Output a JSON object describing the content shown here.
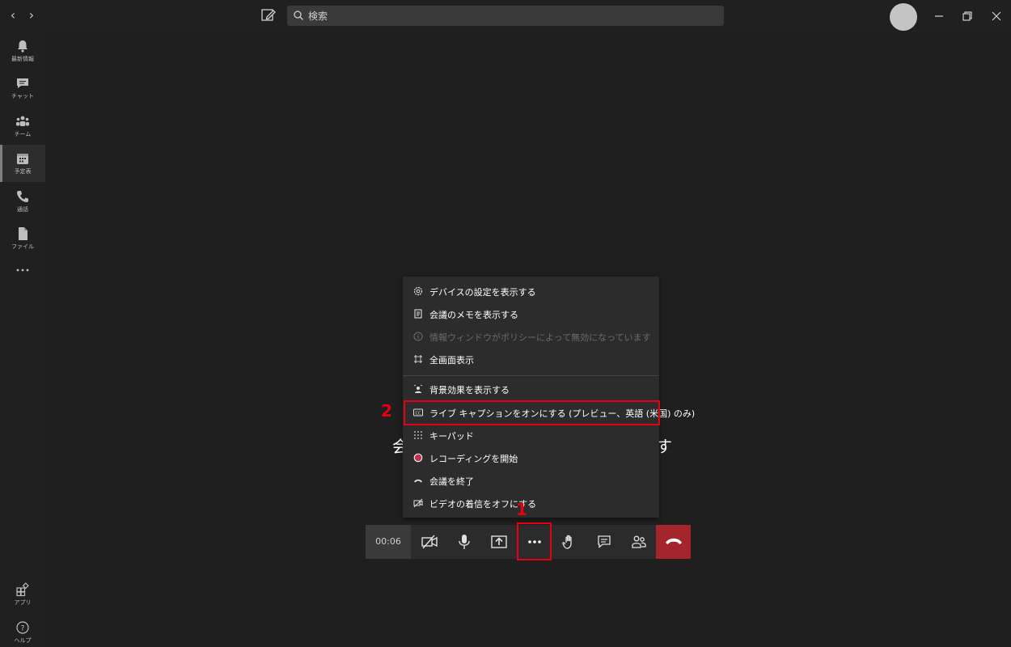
{
  "search": {
    "placeholder": "検索"
  },
  "rail": {
    "items": [
      {
        "label": "最新情報"
      },
      {
        "label": "チャット"
      },
      {
        "label": "チーム"
      },
      {
        "label": "予定表"
      },
      {
        "label": "通話"
      },
      {
        "label": "ファイル"
      }
    ],
    "bottom": [
      {
        "label": "アプリ"
      },
      {
        "label": "ヘルプ"
      }
    ]
  },
  "background_caption": {
    "left": "会",
    "right": "す"
  },
  "menu": {
    "items": [
      {
        "label": "デバイスの設定を表示する"
      },
      {
        "label": "会議のメモを表示する"
      },
      {
        "label": "情報ウィンドウがポリシーによって無効になっています"
      },
      {
        "label": "全画面表示"
      },
      {
        "label": "背景効果を表示する"
      },
      {
        "label": "ライブ キャプションをオンにする (プレビュー、英語 (米国) のみ)"
      },
      {
        "label": "キーパッド"
      },
      {
        "label": "レコーディングを開始"
      },
      {
        "label": "会議を終了"
      },
      {
        "label": "ビデオの着信をオフにする"
      }
    ]
  },
  "toolbar": {
    "timer": "00:06"
  },
  "annotations": {
    "step1": "1",
    "step2": "2"
  },
  "colors": {
    "annotation_red": "#e60012",
    "hangup_red": "#a4262c",
    "recording_dot": "#c4314b"
  }
}
